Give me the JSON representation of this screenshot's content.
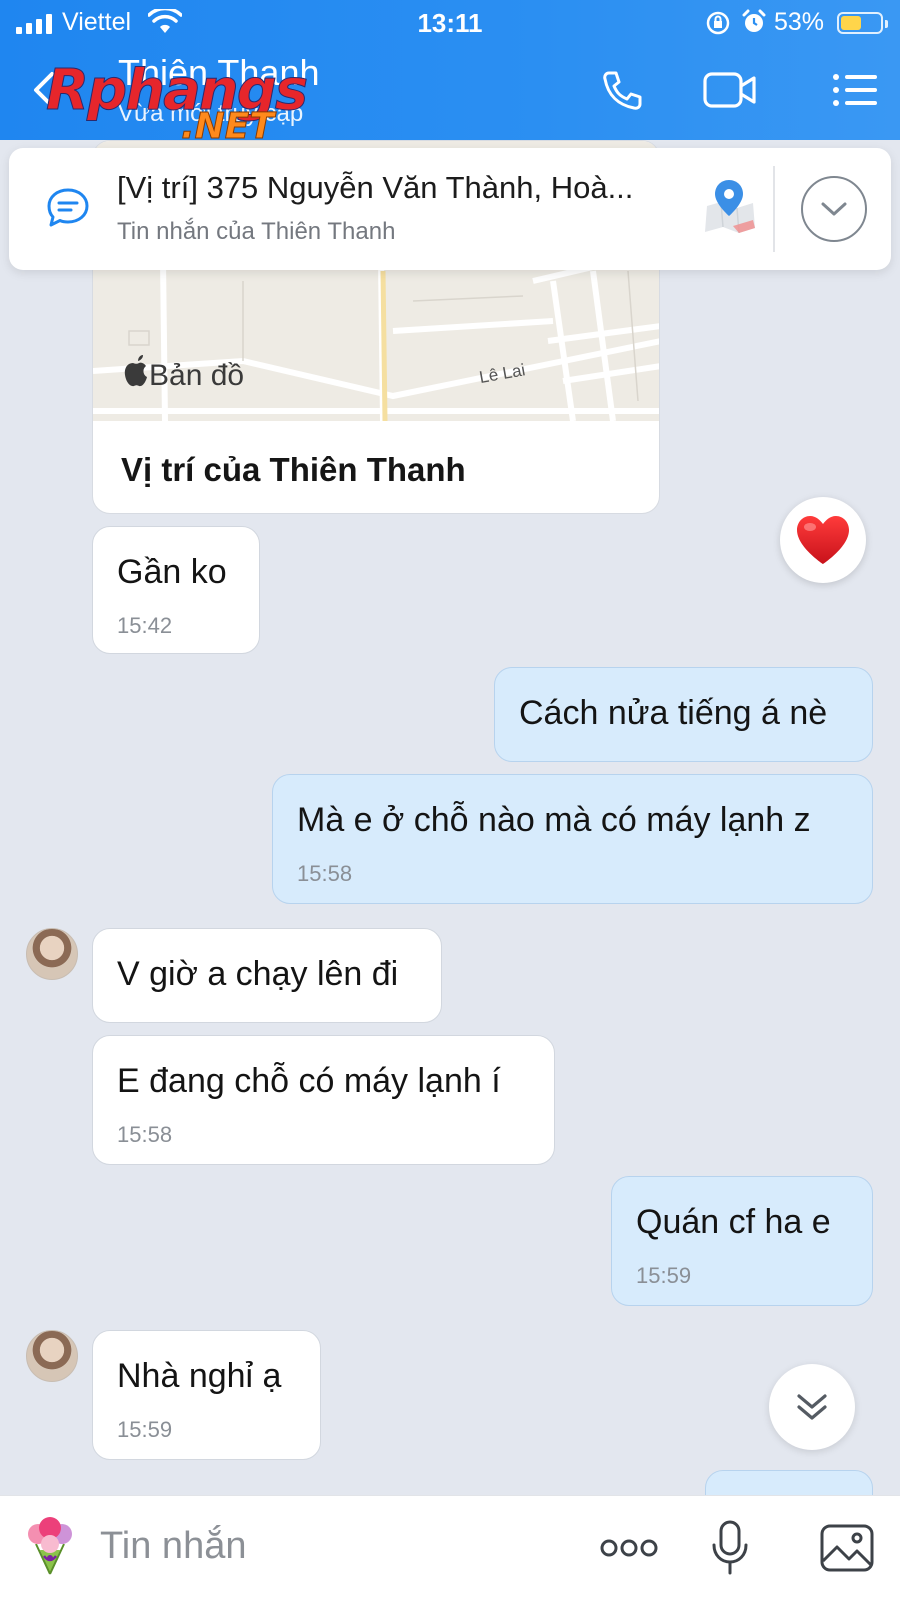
{
  "status_bar": {
    "carrier": "Viettel",
    "time": "13:11",
    "battery_percent": "53%",
    "battery_level": 0.53,
    "icons": [
      "signal-icon",
      "wifi-icon",
      "orientation-lock-icon",
      "alarm-icon",
      "battery-icon"
    ]
  },
  "header": {
    "contact_name": "Thiên Thanh",
    "contact_status": "Vừa mới truy cập",
    "watermark_main": "Rphangs",
    "watermark_suffix": ".NET",
    "actions": [
      "phone-icon",
      "video-icon",
      "menu-icon"
    ]
  },
  "pinned": {
    "title": "[Vị trí] 375 Nguyễn Văn Thành, Hoà...",
    "subtitle": "Tin nhắn của Thiên Thanh"
  },
  "map_card": {
    "brand": "Bản đồ",
    "street": "Lê Lai",
    "label": "Vị trí của Thiên Thanh"
  },
  "messages": [
    {
      "side": "in",
      "text": "Gần ko",
      "time": "15:42"
    },
    {
      "side": "out",
      "text": "Cách nửa tiếng á nè",
      "time": ""
    },
    {
      "side": "out",
      "text": "Mà e ở chỗ nào mà có máy lạnh z",
      "time": "15:58"
    },
    {
      "side": "in",
      "text": "V giờ a chạy lên đi",
      "time": ""
    },
    {
      "side": "in",
      "text": "E đang chỗ có máy lạnh í",
      "time": "15:58"
    },
    {
      "side": "out",
      "text": "Quán cf ha e",
      "time": "15:59"
    },
    {
      "side": "in",
      "text": "Nhà nghỉ ạ",
      "time": "15:59"
    }
  ],
  "reaction": {
    "emoji": "❤️"
  },
  "composer": {
    "placeholder": "Tin nhắn"
  },
  "colors": {
    "header": "#2b8ff2",
    "bubble_out": "#d7ebfc",
    "bubble_in": "#ffffff",
    "background": "#e3e7ef",
    "accent": "#1f86f0"
  }
}
